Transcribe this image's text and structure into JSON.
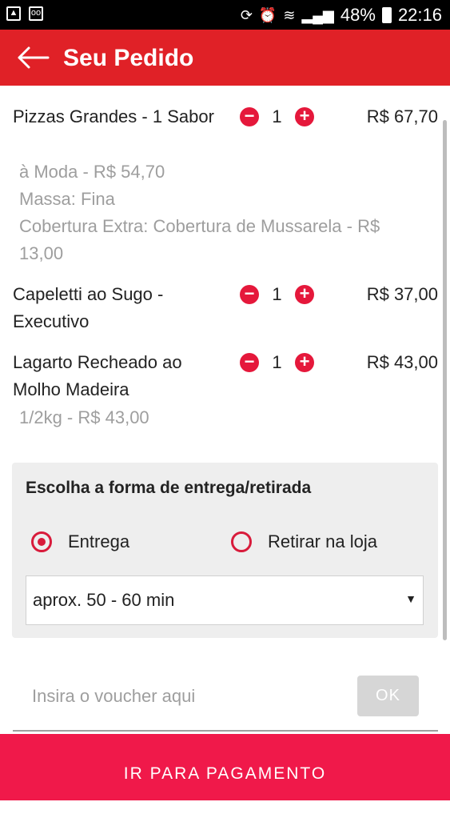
{
  "status_bar": {
    "battery": "48%",
    "time": "22:16"
  },
  "header": {
    "title": "Seu Pedido"
  },
  "items": [
    {
      "name": "Pizzas Grandes - 1 Sabor",
      "quantity": "1",
      "price": "R$ 67,70",
      "details": [
        "à Moda - R$ 54,70",
        "Massa: Fina",
        "Cobertura Extra: Cobertura de Mussarela - R$ 13,00"
      ]
    },
    {
      "name": "Capeletti ao Sugo - Executivo",
      "quantity": "1",
      "price": "R$ 37,00",
      "details": []
    },
    {
      "name": "Lagarto Recheado ao Molho Madeira",
      "quantity": "1",
      "price": "R$ 43,00",
      "details": [
        "1/2kg - R$ 43,00"
      ]
    }
  ],
  "delivery": {
    "title": "Escolha a forma de entrega/retirada",
    "options": [
      "Entrega",
      "Retirar na loja"
    ],
    "selected": "Entrega",
    "time_select": "aprox. 50 - 60 min"
  },
  "voucher": {
    "placeholder": "Insira o voucher aqui",
    "button": "OK"
  },
  "footer": {
    "pay_button": "IR PARA PAGAMENTO"
  },
  "colors": {
    "primary": "#e02127",
    "accent": "#e5183b",
    "pay_button": "#f0194a"
  }
}
